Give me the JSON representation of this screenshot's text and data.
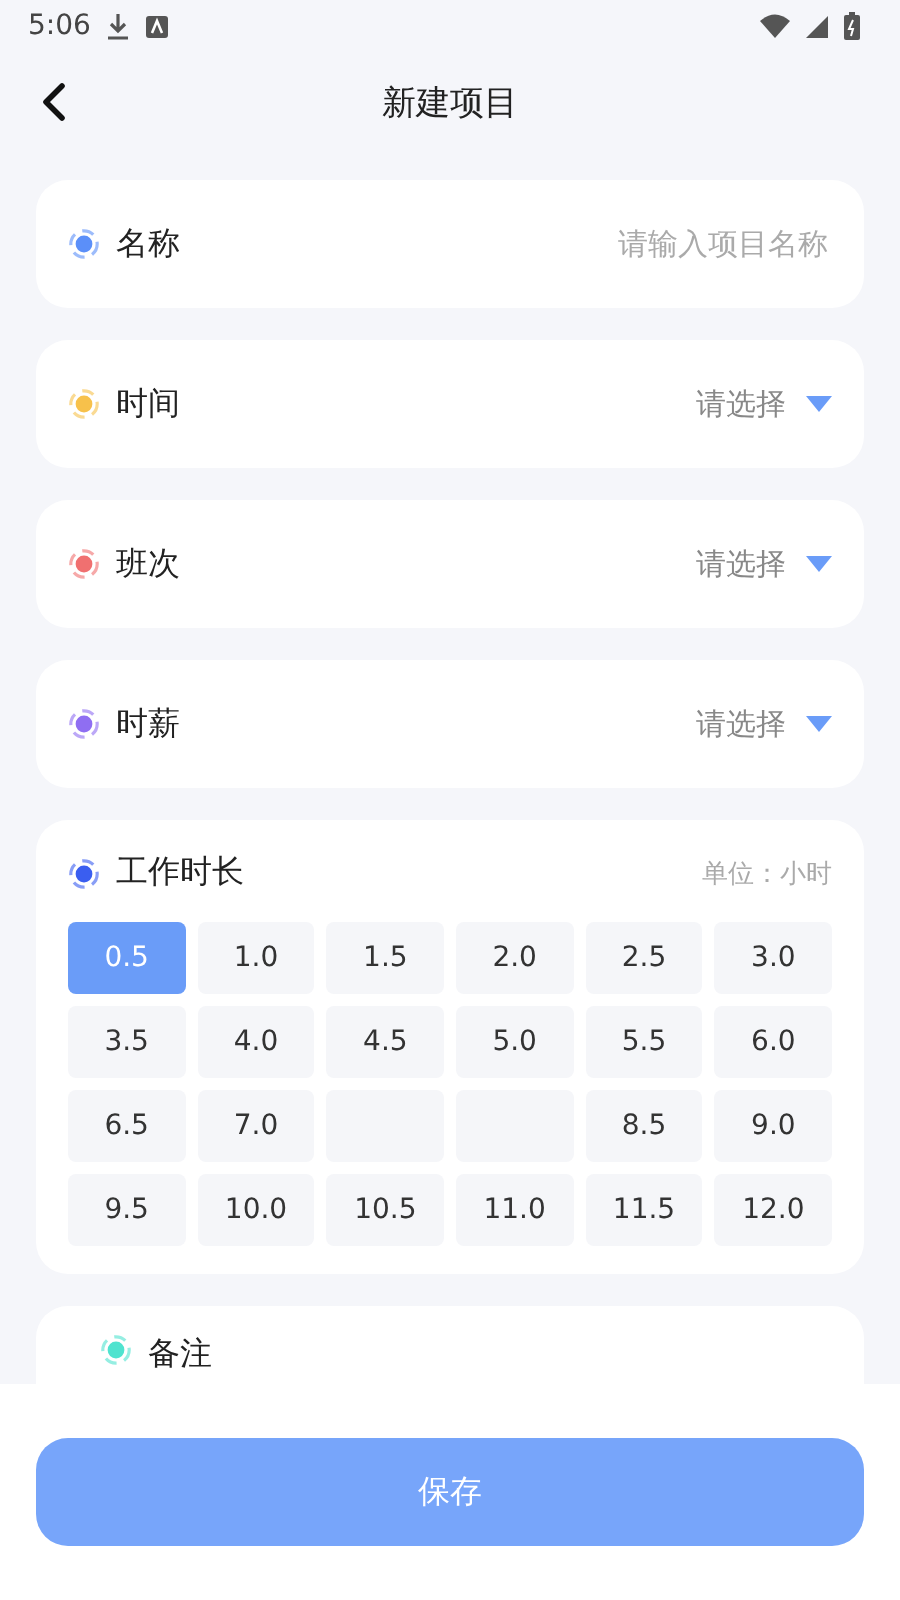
{
  "status_bar": {
    "time": "5:06"
  },
  "header": {
    "title": "新建项目"
  },
  "fields": [
    {
      "label": "名称",
      "kind": "input",
      "placeholder": "请输入项目名称",
      "color": "#5b8ff9"
    },
    {
      "label": "时间",
      "kind": "select",
      "placeholder": "请选择",
      "color": "#f7c14b"
    },
    {
      "label": "班次",
      "kind": "select",
      "placeholder": "请选择",
      "color": "#f07070"
    },
    {
      "label": "时薪",
      "kind": "select",
      "placeholder": "请选择",
      "color": "#8f6ef2"
    }
  ],
  "hours": {
    "label": "工作时长",
    "unit": "单位：小时",
    "color": "#3a5ef0",
    "options": [
      {
        "label": "0.5",
        "selected": true
      },
      {
        "label": "1.0",
        "selected": false
      },
      {
        "label": "1.5",
        "selected": false
      },
      {
        "label": "2.0",
        "selected": false
      },
      {
        "label": "2.5",
        "selected": false
      },
      {
        "label": "3.0",
        "selected": false
      },
      {
        "label": "3.5",
        "selected": false
      },
      {
        "label": "4.0",
        "selected": false
      },
      {
        "label": "4.5",
        "selected": false
      },
      {
        "label": "5.0",
        "selected": false
      },
      {
        "label": "5.5",
        "selected": false
      },
      {
        "label": "6.0",
        "selected": false
      },
      {
        "label": "6.5",
        "selected": false
      },
      {
        "label": "7.0",
        "selected": false
      },
      {
        "selected": false
      },
      {
        "selected": false
      },
      {
        "label": "8.5",
        "selected": false
      },
      {
        "label": "9.0",
        "selected": false
      },
      {
        "label": "9.5",
        "selected": false
      },
      {
        "label": "10.0",
        "selected": false
      },
      {
        "label": "10.5",
        "selected": false
      },
      {
        "label": "11.0",
        "selected": false
      },
      {
        "label": "11.5",
        "selected": false
      },
      {
        "label": "12.0",
        "selected": false
      }
    ]
  },
  "note": {
    "label": "备注",
    "color": "#4fe3cf"
  },
  "save_button": {
    "label": "保存"
  }
}
